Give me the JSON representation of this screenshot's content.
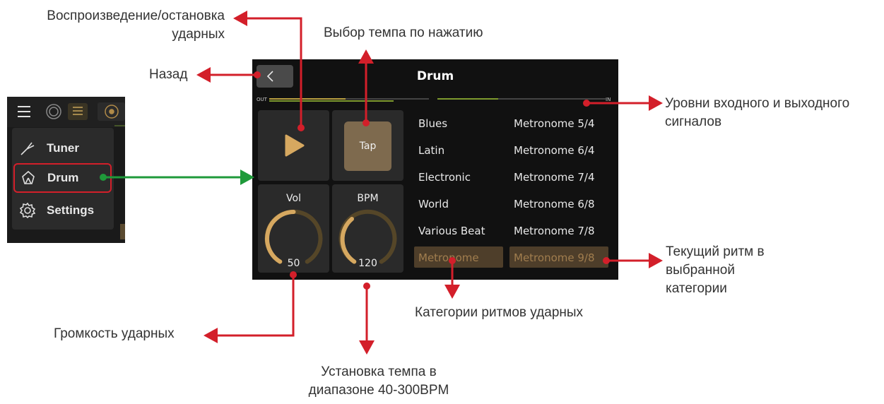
{
  "annotations": {
    "play_stop": [
      "Воспроизведение/остановка",
      "ударных"
    ],
    "tap_tempo": "Выбор темпа по нажатию",
    "back": "Назад",
    "levels": [
      "Уровни входного и выходного",
      "сигналов"
    ],
    "current_rhythm": [
      "Текущий ритм в",
      "выбранной",
      "категории"
    ],
    "categories": "Категории ритмов ударных",
    "drum_volume": "Громкость ударных",
    "tempo_range": [
      "Установка темпа в",
      "диапазоне 40-300BPM"
    ]
  },
  "menu": {
    "items": [
      {
        "label": "Tuner",
        "icon": "tuner-fork-icon"
      },
      {
        "label": "Drum",
        "icon": "drum-icon",
        "highlighted": true
      },
      {
        "label": "Settings",
        "icon": "gear-icon"
      }
    ]
  },
  "screen": {
    "title": "Drum",
    "meter_out_label": "OUT",
    "meter_in_label": "IN",
    "meter_out_level": 0.48,
    "meter_in_level": 0.36,
    "tap_label": "Tap",
    "volume": {
      "label": "Vol",
      "value": "50"
    },
    "bpm": {
      "label": "BPM",
      "value": "120"
    },
    "categories": [
      "Blues",
      "Latin",
      "Electronic",
      "World",
      "Various Beat",
      "Metronome"
    ],
    "rhythms": [
      "Metronome 5/4",
      "Metronome 6/4",
      "Metronome 7/4",
      "Metronome 6/8",
      "Metronome 7/8",
      "Metronome 9/8"
    ],
    "selected_category": "Metronome",
    "selected_rhythm": "Metronome 9/8"
  },
  "colors": {
    "annotation_arrow": "#d31f2a",
    "link_arrow": "#1f9a3a",
    "accent_gold": "#d6a860",
    "selection_bg": "#4e3e2a",
    "tap_bg": "#7e6a4e"
  }
}
